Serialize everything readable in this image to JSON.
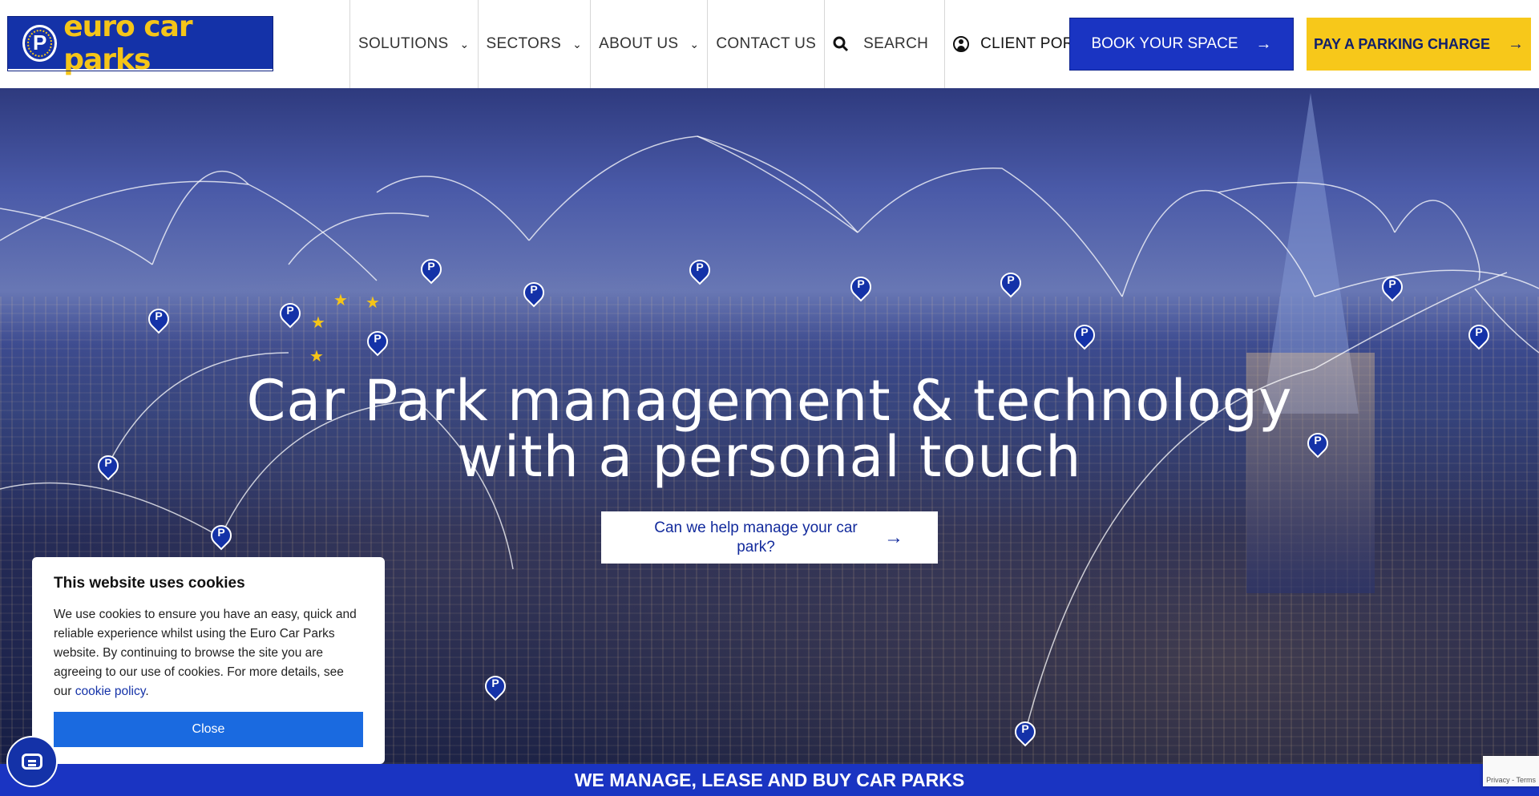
{
  "header": {
    "logo_text": "euro car parks",
    "logo_badge": "P",
    "nav": [
      {
        "label": "SOLUTIONS"
      },
      {
        "label": "SECTORS"
      },
      {
        "label": "ABOUT US"
      },
      {
        "label": "CONTACT US"
      }
    ],
    "search_label": "SEARCH",
    "portal_label": "CLIENT PORTAL",
    "book_label": "BOOK YOUR SPACE",
    "pay_label": "PAY A PARKING CHARGE"
  },
  "hero": {
    "title_line1": "Car Park management & technology",
    "title_line2": "with a personal touch",
    "cta_label": "Can we help manage your car park?",
    "pin_label": "P"
  },
  "cookie": {
    "title": "This website uses cookies",
    "body": "We use cookies to ensure you have an easy, quick and reliable experience whilst using the Euro Car Parks website. By continuing to browse the site you are agreeing to our use of cookies. For more details, see our ",
    "link": "cookie policy",
    "suffix": ".",
    "close_label": "Close"
  },
  "banner": {
    "text": "WE MANAGE, LEASE AND BUY CAR PARKS"
  },
  "recaptcha": {
    "text": "Privacy - Terms"
  },
  "colors": {
    "brand_blue": "#1a34c2",
    "brand_yellow": "#f7c81a",
    "cookie_button": "#1a6ae0"
  }
}
